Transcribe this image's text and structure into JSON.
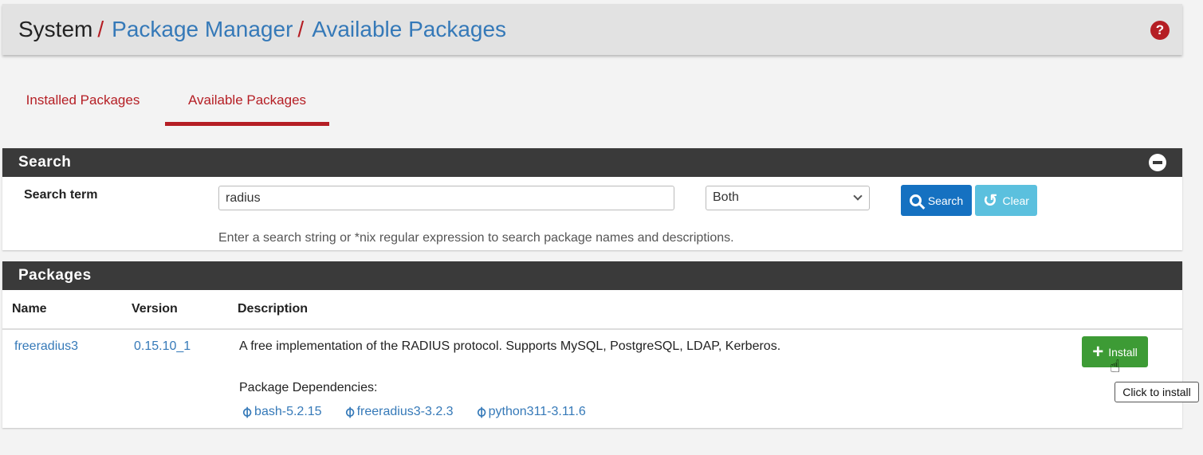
{
  "breadcrumb": {
    "system": "System",
    "separator": "/",
    "package_manager": "Package Manager",
    "current": "Available Packages",
    "help_icon": "question-circle-icon"
  },
  "tabs": [
    {
      "label": "Installed Packages",
      "active": false
    },
    {
      "label": "Available Packages",
      "active": true
    }
  ],
  "search": {
    "panel_title": "Search",
    "term_label": "Search term",
    "term_value": "radius",
    "scope_value": "Both",
    "search_button": "Search",
    "clear_button": "Clear",
    "help_text": "Enter a search string or *nix regular expression to search package names and descriptions."
  },
  "packages": {
    "panel_title": "Packages",
    "columns": [
      "Name",
      "Version",
      "Description"
    ],
    "rows": [
      {
        "name": "freeradius3",
        "version": "0.15.10_1",
        "description": "A free implementation of the RADIUS protocol. Supports MySQL, PostgreSQL, LDAP, Kerberos.",
        "deps_label": "Package Dependencies:",
        "dependencies": [
          "bash-5.2.15",
          "freeradius3-3.2.3",
          "python311-3.11.6"
        ],
        "install_label": "Install"
      }
    ]
  },
  "tooltip": "Click to install",
  "colors": {
    "accent_red": "#b51e24",
    "link_blue": "#3579b8",
    "panel_header": "#3a3a3a",
    "primary_blue": "#1571c1",
    "info_blue": "#5bc0de",
    "success_green": "#3d9b35"
  }
}
